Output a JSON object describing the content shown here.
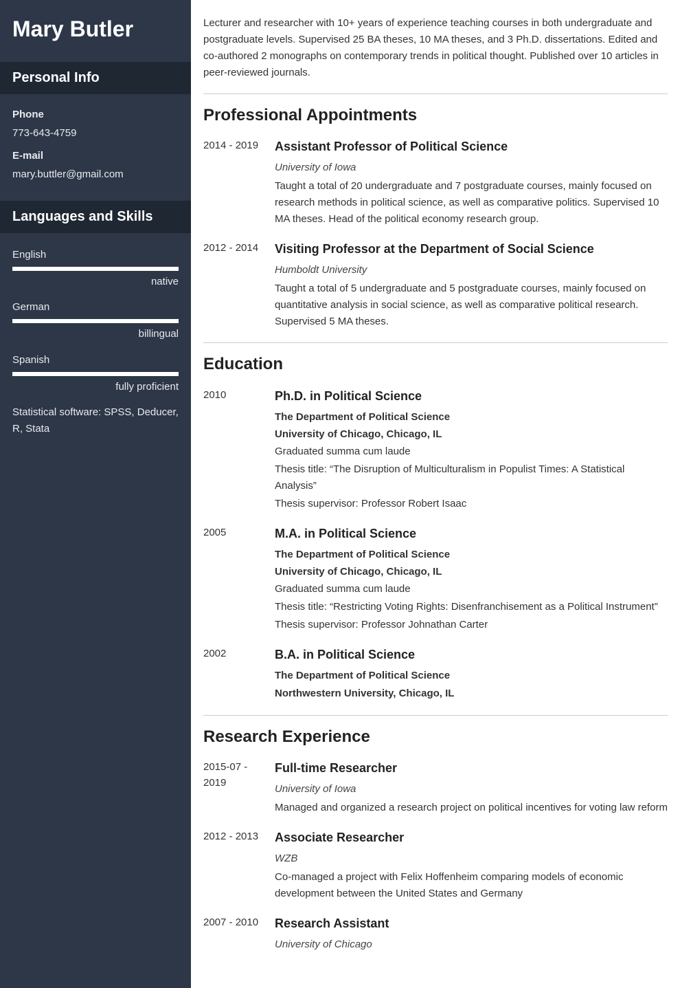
{
  "name": "Mary Butler",
  "personal_info": {
    "heading": "Personal Info",
    "phone_label": "Phone",
    "phone_value": "773-643-4759",
    "email_label": "E-mail",
    "email_value": "mary.buttler@gmail.com"
  },
  "languages_skills": {
    "heading": "Languages and Skills",
    "languages": [
      {
        "name": "English",
        "level": "native"
      },
      {
        "name": "German",
        "level": "billingual"
      },
      {
        "name": "Spanish",
        "level": "fully proficient"
      }
    ],
    "skills_text": "Statistical software: SPSS, Deducer, R, Stata"
  },
  "summary": "Lecturer and researcher with 10+ years of experience teaching courses in both undergraduate and postgraduate levels. Supervised 25 BA theses, 10 MA theses, and 3 Ph.D. dissertations. Edited and co-authored 2 monographs on contemporary trends in political thought. Published over 10 articles in peer-reviewed journals.",
  "appointments": {
    "heading": "Professional Appointments",
    "items": [
      {
        "date": "2014 - 2019",
        "title": "Assistant Professor of Political Science",
        "org": "University of Iowa",
        "desc": "Taught a total of 20 undergraduate and 7 postgraduate courses, mainly focused on research methods in political science, as well as comparative politics. Supervised 10 MA theses. Head of the political economy research group."
      },
      {
        "date": "2012 - 2014",
        "title": "Visiting Professor at the Department of Social Science",
        "org": "Humboldt University",
        "desc": "Taught a total of 5 undergraduate and 5 postgraduate courses, mainly focused on quantitative analysis in social science, as well as comparative political research. Supervised 5 MA theses."
      }
    ]
  },
  "education": {
    "heading": "Education",
    "items": [
      {
        "date": "2010",
        "title": "Ph.D. in Political Science",
        "dept": "The Department of Political Science",
        "uni": "University of Chicago, Chicago, IL",
        "honors": "Graduated summa cum laude",
        "thesis": "Thesis title: “The Disruption of Multiculturalism in Populist Times: A Statistical Analysis”",
        "supervisor": "Thesis supervisor: Professor Robert Isaac"
      },
      {
        "date": "2005",
        "title": "M.A. in Political Science",
        "dept": "The Department of Political Science",
        "uni": "University of Chicago, Chicago, IL",
        "honors": "Graduated summa cum laude",
        "thesis": "Thesis title: “Restricting Voting Rights: Disenfranchisement as a Political Instrument”",
        "supervisor": "Thesis supervisor: Professor Johnathan Carter"
      },
      {
        "date": "2002",
        "title": "B.A. in Political Science",
        "dept": "The Department of Political Science",
        "uni": "Northwestern University, Chicago, IL"
      }
    ]
  },
  "research": {
    "heading": "Research Experience",
    "items": [
      {
        "date": "2015-07 - 2019",
        "title": "Full-time Researcher",
        "org": "University of Iowa",
        "desc": "Managed and organized a research project on political incentives for voting law reform"
      },
      {
        "date": "2012 - 2013",
        "title": "Associate Researcher",
        "org": "WZB",
        "desc": "Co-managed a project with Felix Hoffenheim comparing models of economic development between the United States and Germany"
      },
      {
        "date": "2007 - 2010",
        "title": "Research Assistant",
        "org": "University of Chicago"
      }
    ]
  }
}
